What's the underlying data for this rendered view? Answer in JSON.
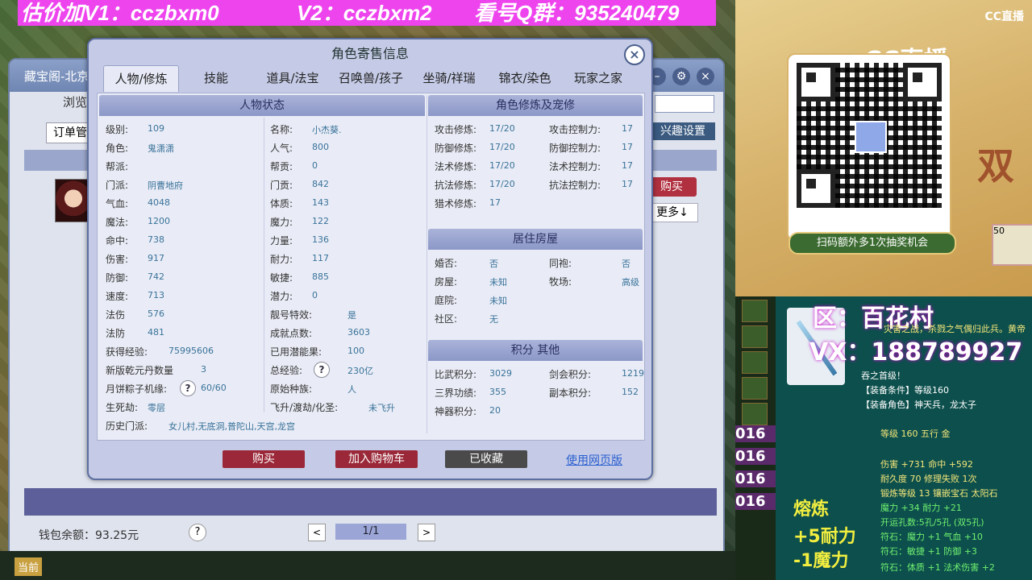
{
  "banner": {
    "price": "估价加V1：cczbxm0",
    "v2": "V2：cczbxm2",
    "qq": "看号Q群：935240479"
  },
  "background_panel": {
    "title": "藏宝阁-北京",
    "browse": "浏览",
    "order_mgmt": "订单管",
    "interest": "兴趣设置",
    "buy": "购买",
    "more": "更多↓",
    "wallet": "钱包余额：93.25元",
    "help": "?",
    "page": "1/1",
    "prev": "<",
    "next": ">",
    "current": "当前"
  },
  "dialog": {
    "title": "角色寄售信息",
    "close": "×",
    "tabs": [
      "人物/修炼",
      "技能",
      "道具/法宝",
      "召唤兽/孩子",
      "坐骑/祥瑞",
      "锦衣/染色",
      "玩家之家"
    ],
    "status_header": "人物状态",
    "status_left": [
      {
        "label": "级别:",
        "value": "109"
      },
      {
        "label": "角色:",
        "value": "鬼潇潇"
      },
      {
        "label": "帮派:",
        "value": ""
      },
      {
        "label": "门派:",
        "value": "阴曹地府"
      },
      {
        "label": "气血:",
        "value": "4048"
      },
      {
        "label": "魔法:",
        "value": "1200"
      },
      {
        "label": "命中:",
        "value": "738"
      },
      {
        "label": "伤害:",
        "value": "917"
      },
      {
        "label": "防御:",
        "value": "742"
      },
      {
        "label": "速度:",
        "value": "713"
      },
      {
        "label": "法伤",
        "value": "576"
      },
      {
        "label": "法防",
        "value": "481"
      },
      {
        "label": "获得经验:",
        "value": "75995606"
      },
      {
        "label": "新版乾元丹数量",
        "value": "3"
      },
      {
        "label": "月饼粽子机缘:",
        "value": "60/60"
      },
      {
        "label": "生死劫:",
        "value": "零层"
      }
    ],
    "status_right": [
      {
        "label": "名称:",
        "value": "小杰葵."
      },
      {
        "label": "人气:",
        "value": "800"
      },
      {
        "label": "帮贡:",
        "value": "0"
      },
      {
        "label": "门贡:",
        "value": "842"
      },
      {
        "label": "体质:",
        "value": "143"
      },
      {
        "label": "魔力:",
        "value": "122"
      },
      {
        "label": "力量:",
        "value": "136"
      },
      {
        "label": "耐力:",
        "value": "117"
      },
      {
        "label": "敏捷:",
        "value": "885"
      },
      {
        "label": "潜力:",
        "value": "0"
      },
      {
        "label": "靓号特效:",
        "value": "是"
      },
      {
        "label": "成就点数:",
        "value": "3603"
      },
      {
        "label": "已用潜能果:",
        "value": "100"
      },
      {
        "label": "总经验:",
        "value": "230亿"
      },
      {
        "label": "原始种族:",
        "value": "人"
      },
      {
        "label": "飞升/渡劫/化圣:",
        "value": "未飞升"
      }
    ],
    "history": {
      "label": "历史门派:",
      "value": "女儿村,无底洞,普陀山,天宫,龙宫"
    },
    "cultivation_header": "角色修炼及宠修",
    "cultivation": [
      {
        "l1": "攻击修炼:",
        "v1": "17/20",
        "l2": "攻击控制力:",
        "v2": "17"
      },
      {
        "l1": "防御修炼:",
        "v1": "17/20",
        "l2": "防御控制力:",
        "v2": "17"
      },
      {
        "l1": "法术修炼:",
        "v1": "17/20",
        "l2": "法术控制力:",
        "v2": "17"
      },
      {
        "l1": "抗法修炼:",
        "v1": "17/20",
        "l2": "抗法控制力:",
        "v2": "17"
      },
      {
        "l1": "猎术修炼:",
        "v1": "17",
        "l2": "",
        "v2": ""
      }
    ],
    "house_header": "居住房屋",
    "house": [
      {
        "l1": "婚否:",
        "v1": "否",
        "l2": "同袍:",
        "v2": "否"
      },
      {
        "l1": "房屋:",
        "v1": "未知",
        "l2": "牧场:",
        "v2": "高级"
      },
      {
        "l1": "庭院:",
        "v1": "未知",
        "l2": "",
        "v2": ""
      },
      {
        "l1": "社区:",
        "v1": "无",
        "l2": "",
        "v2": ""
      }
    ],
    "points_header": "积分 其他",
    "points": [
      {
        "l1": "比武积分:",
        "v1": "3029",
        "l2": "剑会积分:",
        "v2": "1219"
      },
      {
        "l1": "三界功绩:",
        "v1": "355",
        "l2": "副本积分:",
        "v2": "152"
      },
      {
        "l1": "神器积分:",
        "v1": "20",
        "l2": "",
        "v2": ""
      }
    ],
    "buttons": {
      "buy": "购买",
      "cart": "加入购物车",
      "favorited": "已收藏",
      "web": "使用网页版"
    },
    "colors": {
      "buy": "#9a2838",
      "cart": "#9a2838",
      "favorited": "#4a4a4a"
    }
  },
  "stream": {
    "cc_logo": "CC直播",
    "cc_logo_big": "CC直播",
    "scan_banner": "扫码额外多1次抽奖机会",
    "double": "双",
    "fifty": "50",
    "region": "区：百花村",
    "vx": "VX：188789927",
    "nums": [
      "016",
      "016",
      "016",
      "016"
    ],
    "item_lines": [
      {
        "text": "灾害之战，杀戮之气偶归此兵。黄帝",
        "cls": "y"
      },
      {
        "text": "吞之首级！",
        "cls": ""
      },
      {
        "text": "【装备条件】等级160",
        "cls": ""
      },
      {
        "text": "【装备角色】神天兵，龙太子",
        "cls": ""
      },
      {
        "text": "等级 160 五行 金",
        "cls": "y"
      },
      {
        "text": "伤害 +731 命中 +592",
        "cls": "y"
      },
      {
        "text": "耐久度 70 修理失败 1次",
        "cls": "y"
      },
      {
        "text": "锻炼等级 13 镶嵌宝石 太阳石",
        "cls": "y"
      },
      {
        "text": "魔力 +34 耐力 +21",
        "cls": "g"
      },
      {
        "text": "开运孔数:5孔/5孔 (双5孔)",
        "cls": "g"
      },
      {
        "text": "符石：魔力 +1 气血 +10",
        "cls": "g"
      },
      {
        "text": "符石：敏捷 +1 防御 +3",
        "cls": "g"
      },
      {
        "text": "符石：体质 +1 法术伤害 +2",
        "cls": "g"
      }
    ],
    "refine": "熔炼",
    "plus_end": "+5耐力",
    "minus_mag": "-1魔力"
  }
}
